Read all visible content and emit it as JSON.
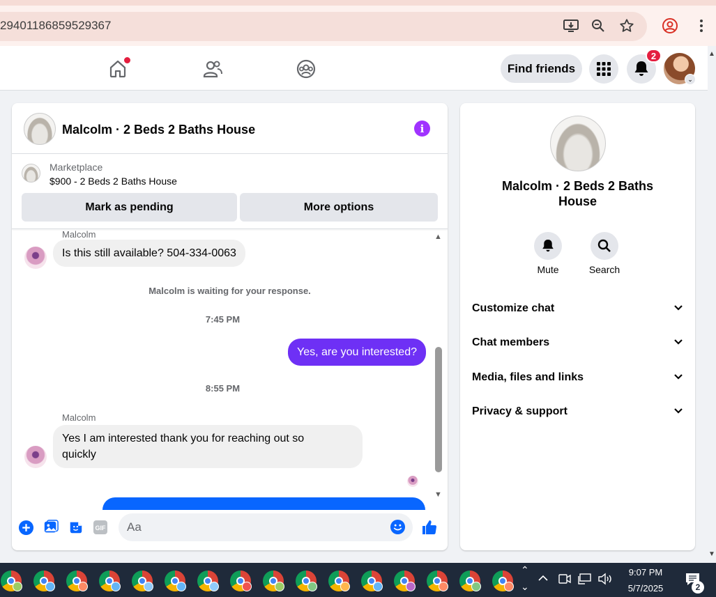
{
  "browser": {
    "url": "29401186859529367",
    "icons": [
      "install-icon",
      "zoom-icon",
      "bookmark-star-icon",
      "account-icon",
      "menu-icon"
    ]
  },
  "header": {
    "find_friends": "Find friends",
    "notification_count": "2",
    "nav": [
      "home-icon",
      "friends-icon",
      "groups-icon"
    ]
  },
  "chat": {
    "title": "Malcolm · 2 Beds 2 Baths House",
    "marketplace_label": "Marketplace",
    "listing": "$900 - 2 Beds 2 Baths House",
    "mark_pending": "Mark as pending",
    "more_options": "More options",
    "messages": [
      {
        "sender": "Malcolm",
        "text": "Is this still available? 504-334-0063",
        "direction": "in"
      },
      {
        "system": "Malcolm is waiting for your response."
      },
      {
        "time": "7:45 PM"
      },
      {
        "text": "Yes, are you interested?",
        "direction": "out"
      },
      {
        "time": "8:55 PM"
      },
      {
        "sender": "Malcolm",
        "text_line1": "Yes I am interested thank you for reaching out so",
        "text_line2": "quickly",
        "direction": "in"
      }
    ],
    "input_placeholder": "Aa"
  },
  "details": {
    "title_line1": "Malcolm · 2 Beds 2 Baths",
    "title_line2": "House",
    "mute": "Mute",
    "search": "Search",
    "sections": [
      "Customize chat",
      "Chat members",
      "Media, files and links",
      "Privacy & support"
    ]
  },
  "taskbar": {
    "time": "9:07 PM",
    "date": "5/7/2025",
    "notifications": "2"
  },
  "colors": {
    "accent_purple": "#6e30f5",
    "fb_blue": "#0866ff",
    "badge_red": "#e41e3f"
  }
}
